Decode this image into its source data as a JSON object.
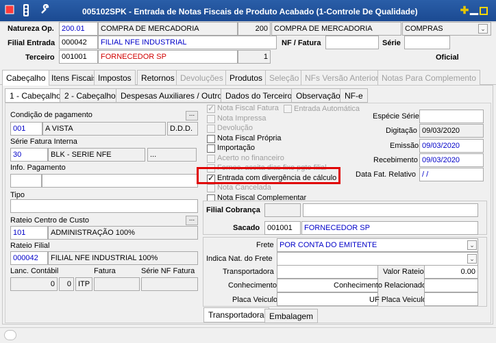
{
  "window": {
    "title": "005102SPK - Entrada de Notas Fiscais de Produto Acabado (1-Controle De Qualidade)"
  },
  "header": {
    "natureza_label": "Natureza Op.",
    "natureza_code": "200.01",
    "natureza_desc": "COMPRA DE MERCADORIA",
    "natureza_num": "200",
    "natureza_desc2": "COMPRA DE MERCADORIA",
    "natureza_type": "COMPRAS",
    "filial_label": "Filial Entrada",
    "filial_code": "000042",
    "filial_name": "FILIAL NFE INDUSTRIAL",
    "nf_label": "NF / Fatura",
    "serie_label": "Série",
    "terceiro_label": "Terceiro",
    "terceiro_code": "001001",
    "terceiro_name": "FORNECEDOR SP",
    "terceiro_num": "1",
    "oficial_label": "Oficial"
  },
  "tabs": [
    "Cabeçalho",
    "Itens Fiscais",
    "Impostos",
    "Retornos",
    "Devoluções",
    "Produtos",
    "Seleção",
    "NFs Versão Anterior",
    "Notas Para Complemento"
  ],
  "subtabs": [
    "1 - Cabeçalho",
    "2 - Cabeçalho",
    "Despesas Auxiliares / Outros",
    "Dados do Terceiro",
    "Observação",
    "NF-e"
  ],
  "left": {
    "cond_label": "Condição de pagamento",
    "cond_code": "001",
    "cond_desc": "A VISTA",
    "cond_ddd": "D.D.D.",
    "serie_label": "Série Fatura Interna",
    "serie_code": "30",
    "serie_desc": "BLK - SERIE NFE",
    "info_label": "Info. Pagamento",
    "tipo_label": "Tipo",
    "rateio_cc_label": "Rateio Centro de Custo",
    "rateio_cc_code": "101",
    "rateio_cc_desc": "ADMINISTRAÇÃO 100%",
    "rateio_filial_label": "Rateio Filial",
    "rateio_filial_code": "000042",
    "rateio_filial_desc": "FILIAL NFE INDUSTRIAL 100%",
    "lanc_label": "Lanc. Contábil",
    "fatura_label": "Fatura",
    "serie_nf_label": "Série NF Fatura",
    "lanc_v1": "0",
    "lanc_v2": "0",
    "lanc_v3": "ITP",
    "dots": "..."
  },
  "checks": [
    {
      "label": "Nota Fiscal Fatura",
      "checked": true,
      "disabled": true
    },
    {
      "label": "Nota Impressa",
      "checked": false,
      "disabled": true
    },
    {
      "label": "Devolução",
      "checked": false,
      "disabled": true
    },
    {
      "label": "Nota Fiscal Própria",
      "checked": false,
      "disabled": false
    },
    {
      "label": "Importação",
      "checked": false,
      "disabled": false
    },
    {
      "label": "Acerto no financeiro",
      "checked": false,
      "disabled": true
    },
    {
      "label": "Fornec. aceita dias fixo pgto filial",
      "checked": false,
      "disabled": true
    },
    {
      "label": "Entrada com divergência de cálculo",
      "checked": true,
      "disabled": false
    },
    {
      "label": "Nota Cancelada",
      "checked": false,
      "disabled": true
    },
    {
      "label": "Nota Fiscal Complementar",
      "checked": false,
      "disabled": false
    }
  ],
  "entrada_auto": "Entrada Automática",
  "right": {
    "especie_label": "Espécie Série",
    "digitacao_label": "Digitação",
    "digitacao": "09/03/2020",
    "emissao_label": "Emissão",
    "emissao": "09/03/2020",
    "recebimento_label": "Recebimento",
    "recebimento": "09/03/2020",
    "data_fat_label": "Data Fat. Relativo",
    "data_fat": " /  /"
  },
  "cobranca": {
    "filial_label": "Filial Cobrança",
    "sacado_label": "Sacado",
    "sacado_code": "001001",
    "sacado_name": "FORNECEDOR SP"
  },
  "transport": {
    "frete_label": "Frete",
    "frete_value": "POR CONTA DO EMITENTE",
    "indica_label": "Indica Nat. do Frete",
    "transportadora_label": "Transportadora",
    "valor_rateio_label": "Valor Rateio",
    "valor_rateio": "0.00",
    "conhecimento_label": "Conhecimento",
    "conh_rel_label": "Conhecimento Relacionado",
    "placa_label": "Placa Veiculo",
    "uf_placa_label": "UF Placa Veiculo",
    "tab_transp": "Transportadora",
    "tab_emb": "Embalagem"
  }
}
